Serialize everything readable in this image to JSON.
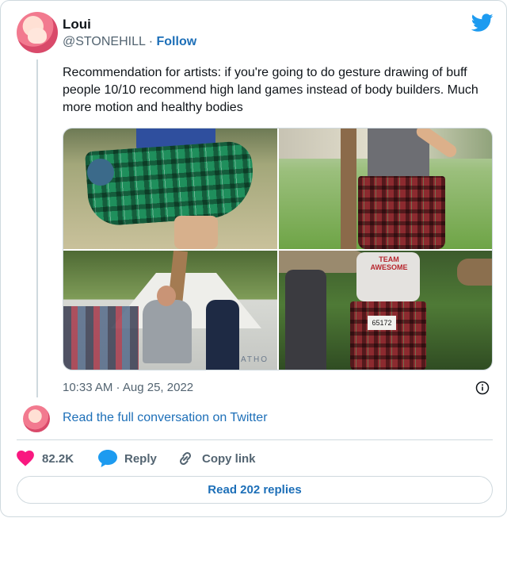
{
  "author": {
    "name": "Loui",
    "handle": "@STONEHILL",
    "separator": " · ",
    "follow_label": "Follow"
  },
  "tweet": {
    "text": "Recommendation for artists: if you're going to do gesture drawing of buff people 10/10 recommend high land games instead of body builders. Much more motion and healthy bodies",
    "timestamp": "10:33 AM · Aug 25, 2022"
  },
  "media": {
    "photo_3_sign_text": "ATHO",
    "photo_4_shirt_text": "TEAM AWESOME",
    "photo_4_bib_text": "65172"
  },
  "conversation_link": "Read the full conversation on Twitter",
  "actions": {
    "like_count": "82.2K",
    "reply_label": "Reply",
    "copy_label": "Copy link"
  },
  "read_replies_label": "Read 202 replies",
  "colors": {
    "link": "#1d6fb8",
    "twitter_blue": "#1d9bf0",
    "like_pink": "#f91880",
    "border": "#cfd9de",
    "muted_text": "#536471"
  },
  "icons": [
    "twitter-bird-icon",
    "info-icon",
    "heart-icon",
    "reply-bubble-icon",
    "link-icon"
  ]
}
